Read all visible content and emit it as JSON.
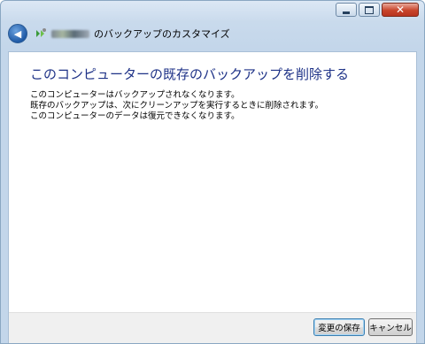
{
  "window": {
    "caption_buttons": {
      "minimize_icon": "minimize-icon",
      "maximize_icon": "maximize-icon",
      "close_glyph": "✕"
    }
  },
  "nav": {
    "back_glyph": "◀",
    "title_suffix": "のバックアップのカスタマイズ"
  },
  "content": {
    "heading": "このコンピューターの既存のバックアップを削除する",
    "lines": [
      "このコンピューターはバックアップされなくなります。",
      "既存のバックアップは、次にクリーンアップを実行するときに削除されます。",
      "このコンピューターのデータは復元できなくなります。"
    ]
  },
  "footer": {
    "save_label": "変更の保存",
    "cancel_label": "キャンセル"
  },
  "colors": {
    "heading": "#1e3287",
    "title_bar": "#c3d6ea",
    "close_button": "#c8442c"
  }
}
